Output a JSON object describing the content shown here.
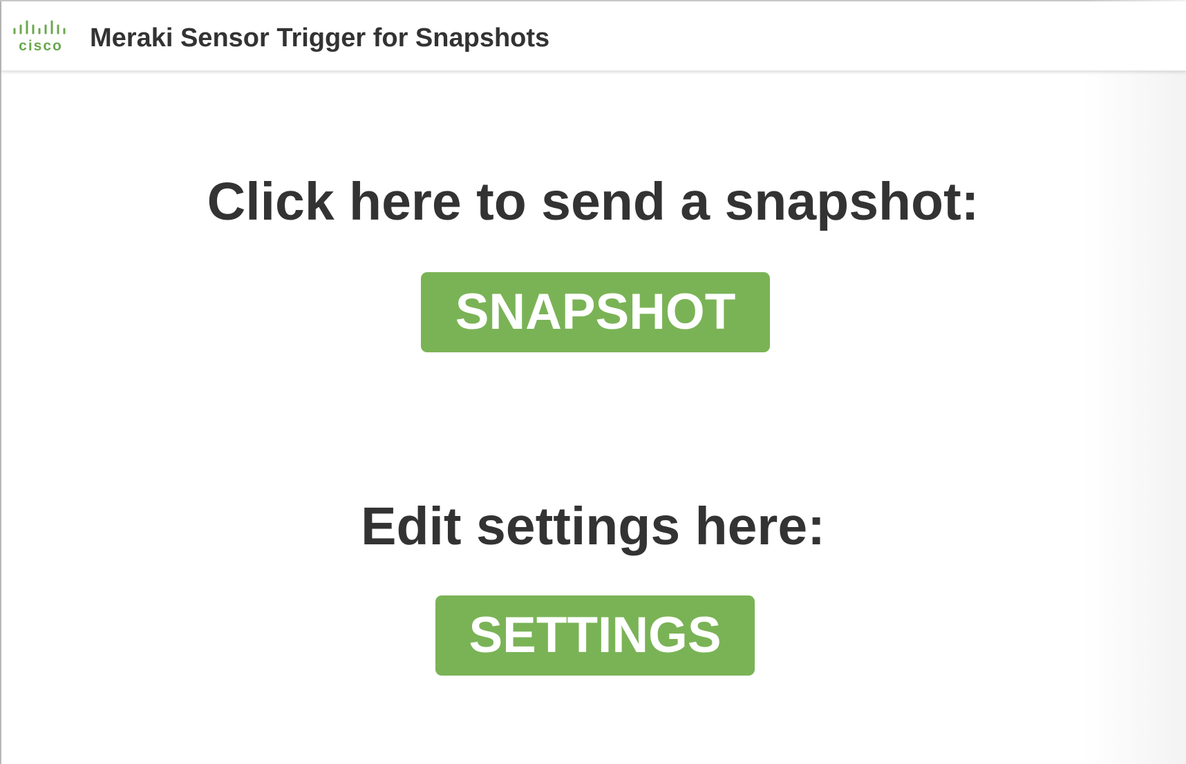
{
  "header": {
    "logo_text": "cisco",
    "title": "Meraki Sensor Trigger for Snapshots"
  },
  "main": {
    "snapshot_prompt": "Click here to send a snapshot:",
    "snapshot_button_label": "SNAPSHOT",
    "settings_prompt": "Edit settings here:",
    "settings_button_label": "SETTINGS"
  },
  "colors": {
    "accent": "#7ab356",
    "text": "#333333",
    "logo": "#6aa84f"
  }
}
